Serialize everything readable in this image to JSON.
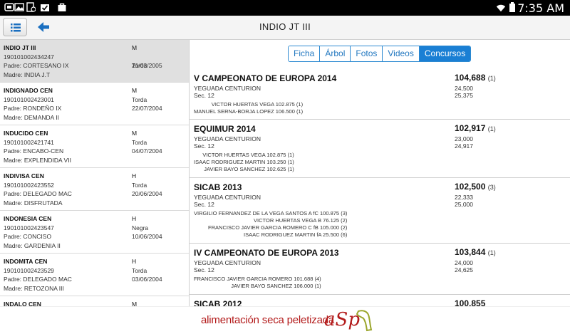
{
  "statusbar": {
    "time": "7:35 AM"
  },
  "header": {
    "title": "INDIO JT III"
  },
  "tabs": [
    {
      "label": "Ficha"
    },
    {
      "label": "Árbol"
    },
    {
      "label": "Fotos"
    },
    {
      "label": "Videos"
    },
    {
      "label": "Concursos"
    }
  ],
  "horses": [
    {
      "name": "INDIO JT III",
      "id": "190101002434247",
      "padre": "Padre: CORTESANO IX",
      "madre": "Madre: INDIA J.T",
      "sex": "M",
      "color": "Torda",
      "date": "21/03/2005"
    },
    {
      "name": "INDIGNADO CEN",
      "id": "190101002423001",
      "padre": "Padre: RONDEÑO IX",
      "madre": "Madre: DEMANDA II",
      "sex": "M",
      "color": "Torda",
      "date": "22/07/2004"
    },
    {
      "name": "INDUCIDO CEN",
      "id": "190101002421741",
      "padre": "Padre: ENCABO-CEN",
      "madre": "Madre: EXPLENDIDA VII",
      "sex": "M",
      "color": "Torda",
      "date": "04/07/2004"
    },
    {
      "name": "INDIVISA CEN",
      "id": "190101002423552",
      "padre": "Padre: DELEGADO MAC",
      "madre": "Madre: DISFRUTADA",
      "sex": "H",
      "color": "Torda",
      "date": "20/06/2004"
    },
    {
      "name": "INDONESIA CEN",
      "id": "190101002423547",
      "padre": "Padre: CONCISO",
      "madre": "Madre: GARDENIA II",
      "sex": "H",
      "color": "Negra",
      "date": "10/06/2004"
    },
    {
      "name": "INDOMITA CEN",
      "id": "190101002423529",
      "padre": "Padre: DELEGADO MAC",
      "madre": "Madre: RETOZONA III",
      "sex": "H",
      "color": "Torda",
      "date": "03/06/2004"
    },
    {
      "name": "INDALO CEN",
      "id": "",
      "padre": "",
      "madre": "",
      "sex": "M",
      "color": "",
      "date": ""
    }
  ],
  "contests": [
    {
      "name": "V CAMPEONATO DE EUROPA 2014",
      "owner": "YEGUADA CENTURION",
      "section": "Sec. 12",
      "score": "104,688",
      "rank": "(1)",
      "v1": "24,500",
      "v2": "25,375",
      "judges": [
        "VICTOR HUERTAS VEGA    102.875 (1)",
        "MANUEL SERNA-BORJA LOPEZ    106.500 (1)"
      ]
    },
    {
      "name": "EQUIMUR 2014",
      "owner": "YEGUADA CENTURION",
      "section": "Sec. 12",
      "score": "102,917",
      "rank": "(1)",
      "v1": "23,000",
      "v2": "24,917",
      "judges": [
        "VICTOR HUERTAS VEGA    102.875 (1)",
        "ISAAC RODRIGUEZ MARTIN    103.250 (1)",
        "JAVIER BAYO SANCHEZ    102.625 (1)"
      ]
    },
    {
      "name": "SICAB 2013",
      "owner": "YEGUADA CENTURION",
      "section": "Sec. 12",
      "score": "102,500",
      "rank": "(3)",
      "v1": "22,333",
      "v2": "25,000",
      "judges": [
        "VIRGILIO FERNANDEZ DE LA VEGA SANTOS  A fC  100.875 (3)",
        "VICTOR HUERTAS VEGA  B  76.125 (2)",
        "FRANCISCO JAVIER GARCIA ROMERO  C fB  105.000 (2)",
        "ISAAC RODRIGUEZ MARTIN  fA  25.500 (6)"
      ]
    },
    {
      "name": "IV CAMPEONATO DE EUROPA 2013",
      "owner": "YEGUADA CENTURION",
      "section": "Sec. 12",
      "score": "103,844",
      "rank": "(1)",
      "v1": "24,000",
      "v2": "24,625",
      "judges": [
        "FRANCISCO JAVIER GARCIA ROMERO    101.688 (4)",
        "JAVIER BAYO SANCHEZ    106.000 (1)"
      ]
    },
    {
      "name": "SICAB 2012",
      "owner": "",
      "section": "",
      "score": "100,855",
      "rank": "",
      "v1": "",
      "v2": "",
      "judges": []
    }
  ],
  "ad": {
    "text": "alimentación seca peletizada",
    "logo": "aSp"
  },
  "colors": {
    "accent": "#1a7fd4",
    "ad": "#b31b1b"
  }
}
